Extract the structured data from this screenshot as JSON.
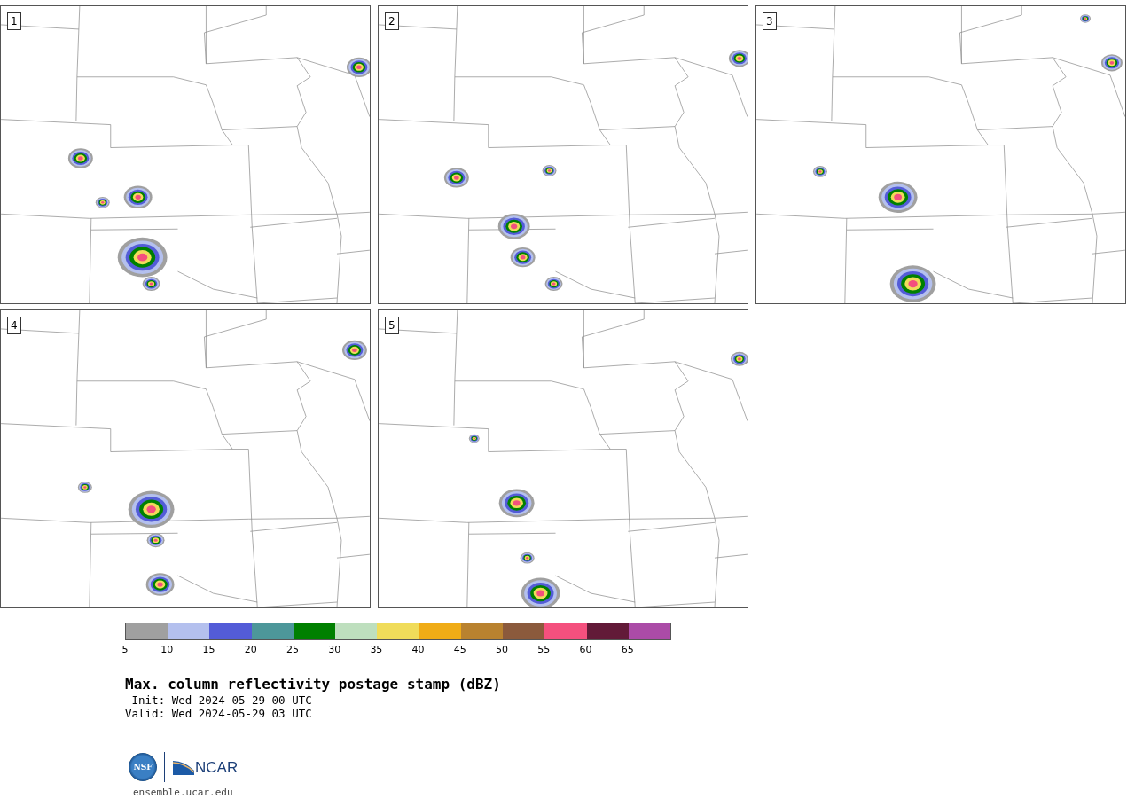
{
  "panels": [
    {
      "label": "1"
    },
    {
      "label": "2"
    },
    {
      "label": "3"
    },
    {
      "label": "4"
    },
    {
      "label": "5"
    }
  ],
  "colorbar": {
    "segments": [
      {
        "color": "#a0a0a0"
      },
      {
        "color": "#b4c0ee"
      },
      {
        "color": "#535cd8"
      },
      {
        "color": "#4d979a"
      },
      {
        "color": "#008000"
      },
      {
        "color": "#bedfbe"
      },
      {
        "color": "#f0dc5a"
      },
      {
        "color": "#f0ac16"
      },
      {
        "color": "#b9822f"
      },
      {
        "color": "#8b5a3c"
      },
      {
        "color": "#f4507e"
      },
      {
        "color": "#621a38"
      },
      {
        "color": "#ab4ba7"
      }
    ],
    "ticks": [
      "5",
      "10",
      "15",
      "20",
      "25",
      "30",
      "35",
      "40",
      "45",
      "50",
      "55",
      "60",
      "65"
    ]
  },
  "title": "Max. column reflectivity postage stamp (dBZ)",
  "init": " Init: Wed 2024-05-29 00 UTC",
  "valid": "Valid: Wed 2024-05-29 03 UTC",
  "logos": {
    "nsf": "NSF",
    "ncar": "NCAR"
  },
  "url": "ensemble.ucar.edu"
}
